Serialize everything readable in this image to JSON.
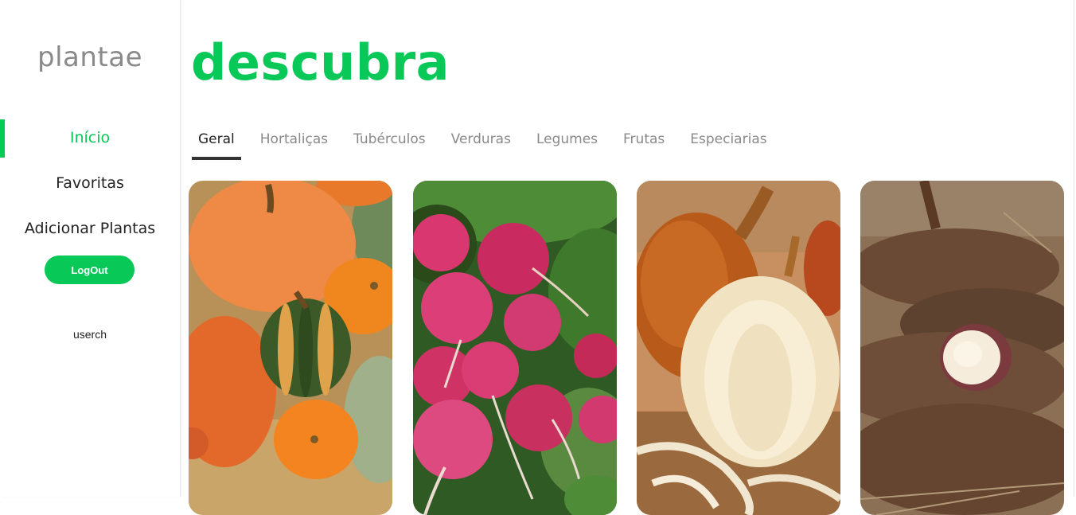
{
  "sidebar": {
    "logo": "plantae",
    "nav": [
      {
        "label": "Início",
        "active": true
      },
      {
        "label": "Favoritas",
        "active": false
      },
      {
        "label": "Adicionar Plantas",
        "active": false
      }
    ],
    "logout_label": "LogOut",
    "username": "userch"
  },
  "main": {
    "title": "descubra",
    "tabs": [
      "Geral",
      "Hortaliças",
      "Tubérculos",
      "Verduras",
      "Legumes",
      "Frutas",
      "Especiarias"
    ],
    "active_tab": "Geral",
    "cards": [
      {
        "image": "pumpkins-photo"
      },
      {
        "image": "radishes-photo"
      },
      {
        "image": "onion-photo"
      },
      {
        "image": "cassava-photo"
      }
    ]
  },
  "colors": {
    "accent": "#08c858",
    "text": "#222222",
    "muted": "#8a8a8a"
  }
}
